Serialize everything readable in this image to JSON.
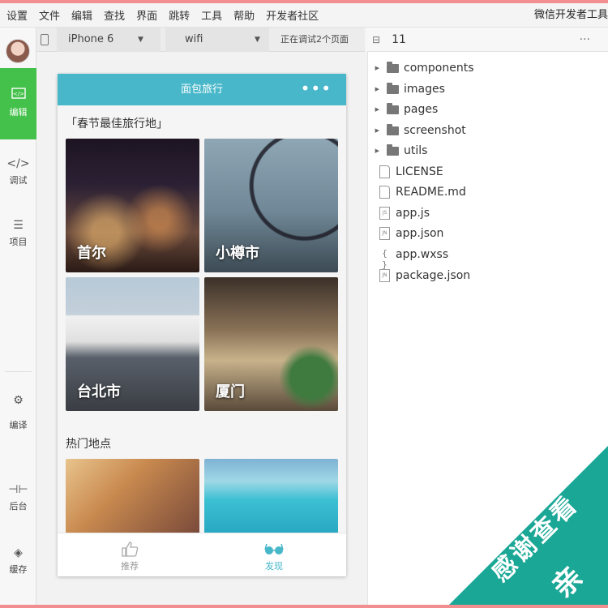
{
  "menu": [
    "设置",
    "文件",
    "编辑",
    "查找",
    "界面",
    "跳转",
    "工具",
    "帮助",
    "开发者社区"
  ],
  "app_title": "微信开发者工具",
  "sidebar": {
    "items": [
      {
        "label": "编辑",
        "icon": "code-icon"
      },
      {
        "label": "调试",
        "icon": "debug-icon"
      },
      {
        "label": "项目",
        "icon": "list-icon"
      },
      {
        "label": "编译",
        "icon": "compile-icon"
      },
      {
        "label": "后台",
        "icon": "background-icon"
      },
      {
        "label": "缓存",
        "icon": "cache-icon"
      }
    ]
  },
  "sim_toolbar": {
    "device": "iPhone 6",
    "network": "wifi",
    "debug": "正在调试2个页面"
  },
  "phone": {
    "nav_title": "面包旅行",
    "nav_more": "•••",
    "section1_title": "「春节最佳旅行地」",
    "cards": [
      {
        "label": "首尔"
      },
      {
        "label": "小樽市"
      },
      {
        "label": "台北市"
      },
      {
        "label": "厦门"
      }
    ],
    "section2_title": "热门地点",
    "tabs": [
      {
        "label": "推荐",
        "icon": "thumbs-up-icon"
      },
      {
        "label": "发现",
        "icon": "glasses-icon"
      }
    ]
  },
  "file_toolbar": {
    "count": "11"
  },
  "files": [
    {
      "name": "components",
      "type": "folder"
    },
    {
      "name": "images",
      "type": "folder"
    },
    {
      "name": "pages",
      "type": "folder"
    },
    {
      "name": "screenshot",
      "type": "folder"
    },
    {
      "name": "utils",
      "type": "folder"
    },
    {
      "name": "LICENSE",
      "type": "file",
      "badge": ""
    },
    {
      "name": "README.md",
      "type": "file",
      "badge": ""
    },
    {
      "name": "app.js",
      "type": "file",
      "badge": "JS"
    },
    {
      "name": "app.json",
      "type": "file",
      "badge": "JN"
    },
    {
      "name": "app.wxss",
      "type": "braces",
      "badge": "{ }"
    },
    {
      "name": "package.json",
      "type": "file",
      "badge": "JN"
    }
  ],
  "ribbon": {
    "line1": "感谢查看",
    "line2": "亲"
  },
  "colors": {
    "accent_green": "#44c14a",
    "nav_teal": "#47b7c9",
    "ribbon_teal": "#1aa796",
    "top_border": "#f28e90"
  }
}
